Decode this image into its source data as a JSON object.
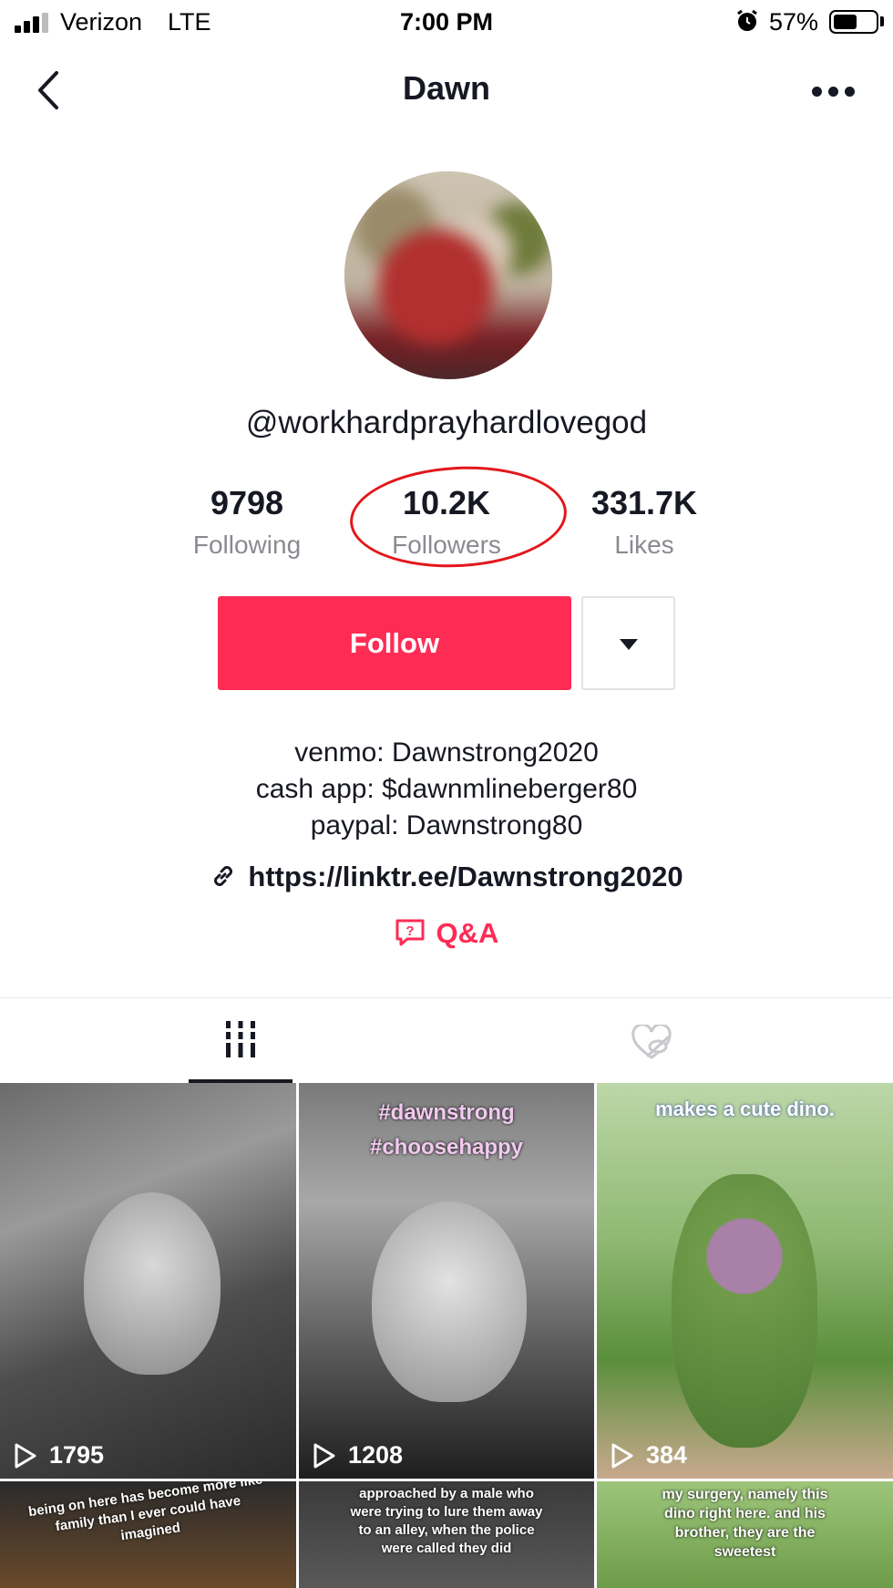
{
  "status_bar": {
    "carrier": "Verizon",
    "network": "LTE",
    "time": "7:00 PM",
    "battery_percent": "57%",
    "battery_level": 0.57
  },
  "header": {
    "title": "Dawn",
    "back_icon": "chevron-left-icon",
    "more_icon": "ellipsis-icon"
  },
  "profile": {
    "username": "@workhardprayhardlovegod",
    "stats": [
      {
        "value": "9798",
        "label": "Following"
      },
      {
        "value": "10.2K",
        "label": "Followers"
      },
      {
        "value": "331.7K",
        "label": "Likes"
      }
    ],
    "follow_label": "Follow",
    "bio_lines": [
      "venmo: Dawnstrong2020",
      "cash app: $dawnmlineberger80",
      "paypal: Dawnstrong80"
    ],
    "link": "https://linktr.ee/Dawnstrong2020",
    "qa_label": "Q&A"
  },
  "tabs": [
    {
      "icon": "grid-videos-icon",
      "active": true
    },
    {
      "icon": "liked-hidden-icon",
      "active": false
    }
  ],
  "videos": [
    {
      "views": "1795",
      "caption": ""
    },
    {
      "views": "1208",
      "caption": "#dawnstrong #choosehappy"
    },
    {
      "views": "384",
      "caption": "makes a cute dino."
    },
    {
      "views": "",
      "caption": "being on here has become more like family than I ever could have imagined"
    },
    {
      "views": "",
      "caption": "approached by a male who were trying to lure them away to an alley, when the police were called they did"
    },
    {
      "views": "",
      "caption": "my surgery, namely this dino right here. and his brother, they are the sweetest"
    }
  ],
  "colors": {
    "accent": "#fe2c55",
    "text_primary": "#161823",
    "text_secondary": "#8a8b91",
    "annotation_circle": "#e3171b"
  }
}
